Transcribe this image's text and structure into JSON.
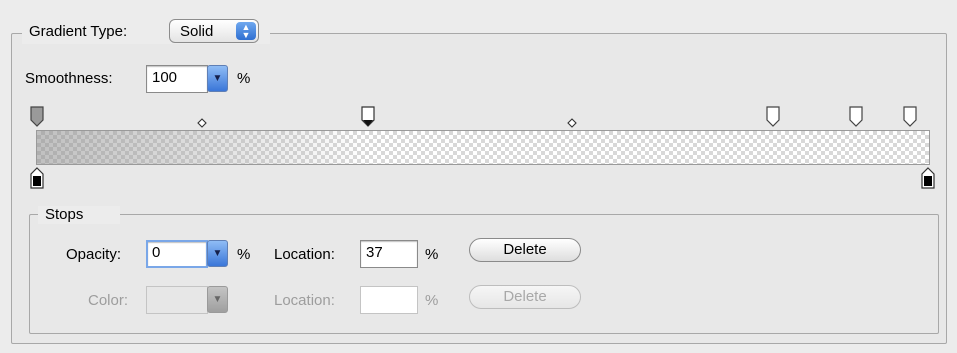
{
  "gradient_type": {
    "label": "Gradient Type:",
    "value": "Solid"
  },
  "smoothness": {
    "label": "Smoothness:",
    "value": "100",
    "unit": "%"
  },
  "gradient": {
    "opacity_stops": [
      0,
      37,
      82,
      92,
      98
    ],
    "midpoints": [
      18,
      60
    ],
    "color_stops": [
      0,
      100
    ]
  },
  "stops": {
    "title": "Stops",
    "opacity": {
      "label": "Opacity:",
      "value": "0",
      "unit": "%"
    },
    "opacity_location": {
      "label": "Location:",
      "value": "37",
      "unit": "%"
    },
    "delete_label": "Delete",
    "color": {
      "label": "Color:"
    },
    "color_location": {
      "label": "Location:",
      "value": "",
      "unit": "%"
    },
    "color_delete_label": "Delete"
  }
}
